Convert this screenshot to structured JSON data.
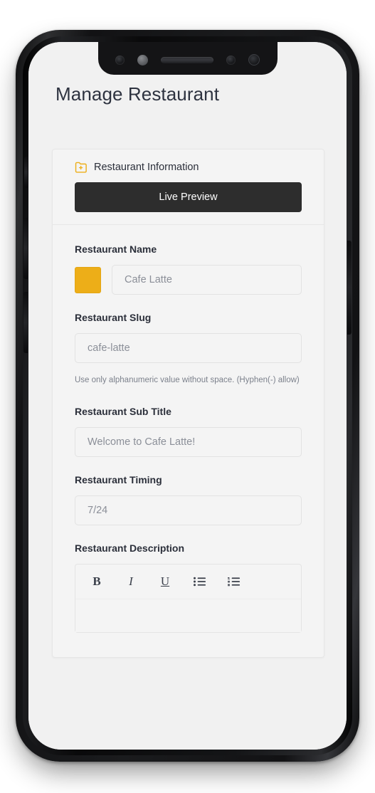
{
  "page": {
    "title": "Manage Restaurant"
  },
  "card": {
    "header": {
      "icon": "folder-plus-icon",
      "title": "Restaurant Information",
      "live_preview_label": "Live Preview"
    },
    "fields": [
      {
        "label": "Restaurant Name",
        "swatch_color": "#edae18",
        "placeholder": "Cafe Latte",
        "value": ""
      },
      {
        "label": "Restaurant Slug",
        "placeholder": "cafe-latte",
        "value": "",
        "helper": "Use only alphanumeric value without space. (Hyphen(-) allow)"
      },
      {
        "label": "Restaurant Sub Title",
        "placeholder": "Welcome to Cafe Latte!",
        "value": ""
      },
      {
        "label": "Restaurant Timing",
        "placeholder": "7/24",
        "value": ""
      },
      {
        "label": "Restaurant Description"
      }
    ],
    "editor": {
      "tools": [
        {
          "name": "bold-icon",
          "glyph": "B"
        },
        {
          "name": "italic-icon",
          "glyph": "I"
        },
        {
          "name": "underline-icon",
          "glyph": "U"
        },
        {
          "name": "bullet-list-icon",
          "glyph": ""
        },
        {
          "name": "numbered-list-icon",
          "glyph": ""
        }
      ]
    }
  },
  "device": {
    "notch": {
      "sensor": "proximity-sensor-icon",
      "dot": "ambient-light-sensor-icon",
      "speaker": "earpiece-speaker",
      "camera": "front-camera-icon"
    },
    "buttons": {
      "silent": "silent-switch",
      "volume_up": "volume-up-button",
      "volume_down": "volume-down-button",
      "power": "power-button"
    }
  },
  "colors": {
    "accent": "#edae18",
    "button_dark": "#2d2d2d",
    "page_bg": "#f1f1f1",
    "card_bg": "#f4f4f4",
    "text_dark": "#2b2f3a",
    "text_muted": "#7c818c"
  }
}
